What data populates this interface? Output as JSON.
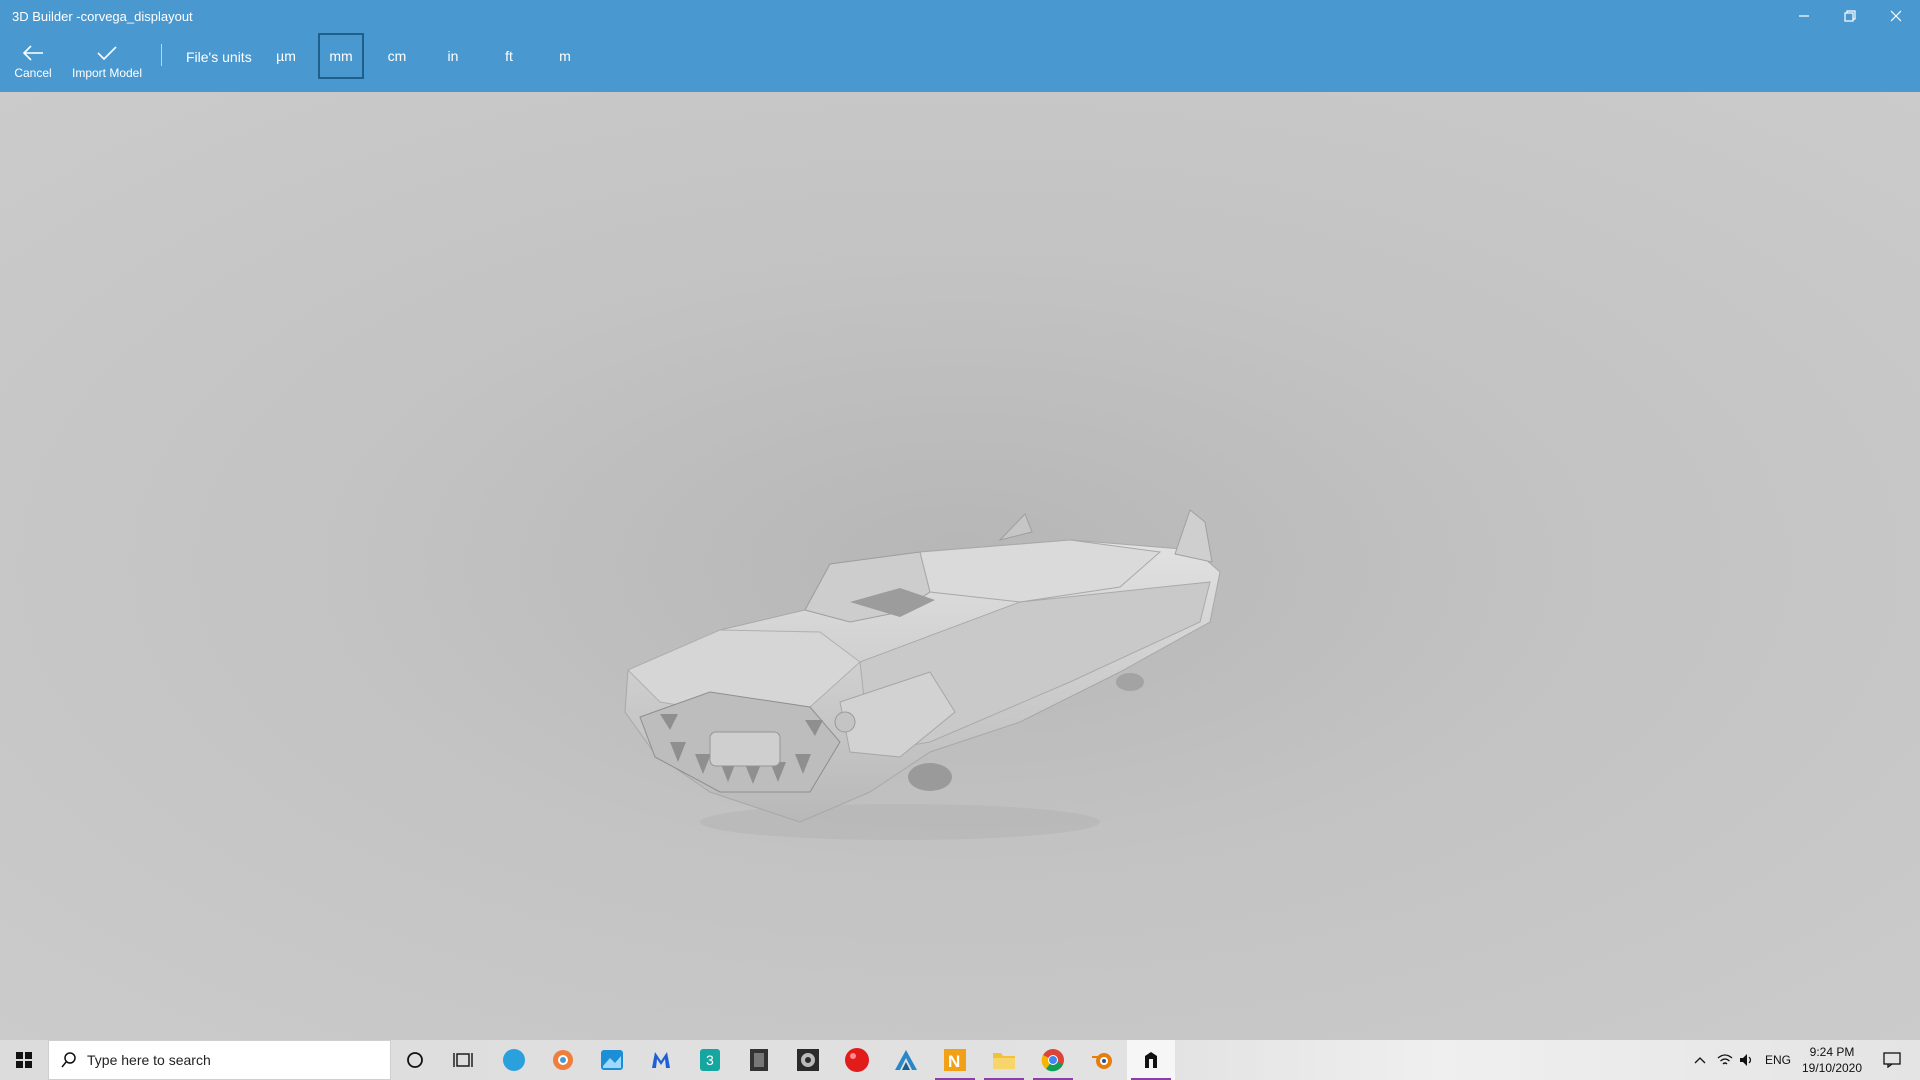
{
  "window": {
    "title": "3D Builder -corvega_displayout",
    "controls": [
      "minimize",
      "restore",
      "close"
    ]
  },
  "toolbar": {
    "cancel_label": "Cancel",
    "import_label": "Import Model",
    "units_label": "File's units",
    "units": [
      {
        "label": "µm",
        "selected": false
      },
      {
        "label": "mm",
        "selected": true
      },
      {
        "label": "cm",
        "selected": false
      },
      {
        "label": "in",
        "selected": false
      },
      {
        "label": "ft",
        "selected": false
      },
      {
        "label": "m",
        "selected": false
      }
    ]
  },
  "viewport": {
    "model": "car-model"
  },
  "taskbar": {
    "search_placeholder": "Type here to search",
    "apps": [
      "cortana-icon",
      "task-view-icon",
      "edge-icon",
      "paint3d-icon",
      "photos-icon",
      "malwarebytes-icon",
      "3dbuilder-app-icon",
      "game-icon",
      "camera-icon",
      "record-icon",
      "vectorworks-icon",
      "n-app-icon",
      "file-explorer-icon",
      "chrome-icon",
      "blender-icon",
      "current-app-icon"
    ],
    "tray": {
      "language": "ENG",
      "time": "9:24 PM",
      "date": "19/10/2020"
    }
  }
}
